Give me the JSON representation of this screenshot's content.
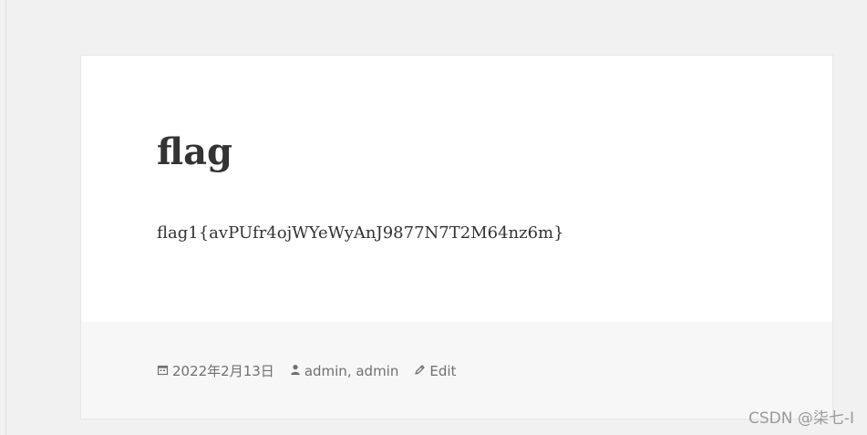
{
  "post": {
    "title": "flag",
    "content": "flag1{avPUfr4ojWYeWyAnJ9877N7T2M64nz6m}"
  },
  "footer": {
    "date": "2022年2月13日",
    "author1": "admin",
    "author_separator": ", ",
    "author2": "admin",
    "edit_label": "Edit"
  },
  "icons": {
    "date": "calendar-icon",
    "author": "person-icon",
    "edit": "pencil-icon"
  },
  "colors": {
    "page_background": "#f1f1f1",
    "card_background": "#ffffff",
    "footer_background": "#f7f7f7",
    "title": "#333333",
    "meta": "#707070"
  },
  "watermark": "CSDN @柒七-I"
}
